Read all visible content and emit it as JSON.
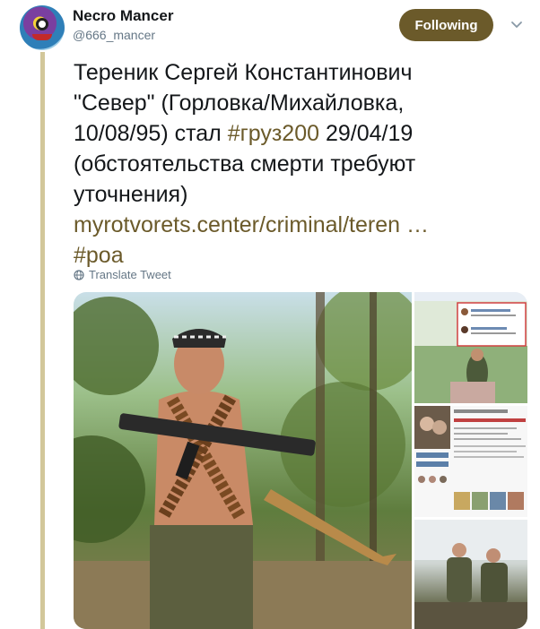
{
  "user": {
    "display_name": "Necro Mancer",
    "handle": "@666_mancer"
  },
  "follow_button": {
    "label": "Following"
  },
  "tweet": {
    "line1": "Тереник Сергей Константинович",
    "line2": "\"Север\" (Горловка/Михайловка,",
    "line3_a": "10/08/95) стал ",
    "line3_tag": "#груз200",
    "line3_b": " 29/04/19",
    "line4": "(обстоятельства смерти требуют",
    "line5": "уточнения)",
    "link": "myrotvorets.center/criminal/teren …",
    "tag2": "#роа"
  },
  "translate": {
    "label": "Translate Tweet",
    "icon": "globe-icon"
  },
  "colors": {
    "accent": "#6b5a2a",
    "thread_line": "#d2c79a",
    "secondary_text": "#657786"
  }
}
